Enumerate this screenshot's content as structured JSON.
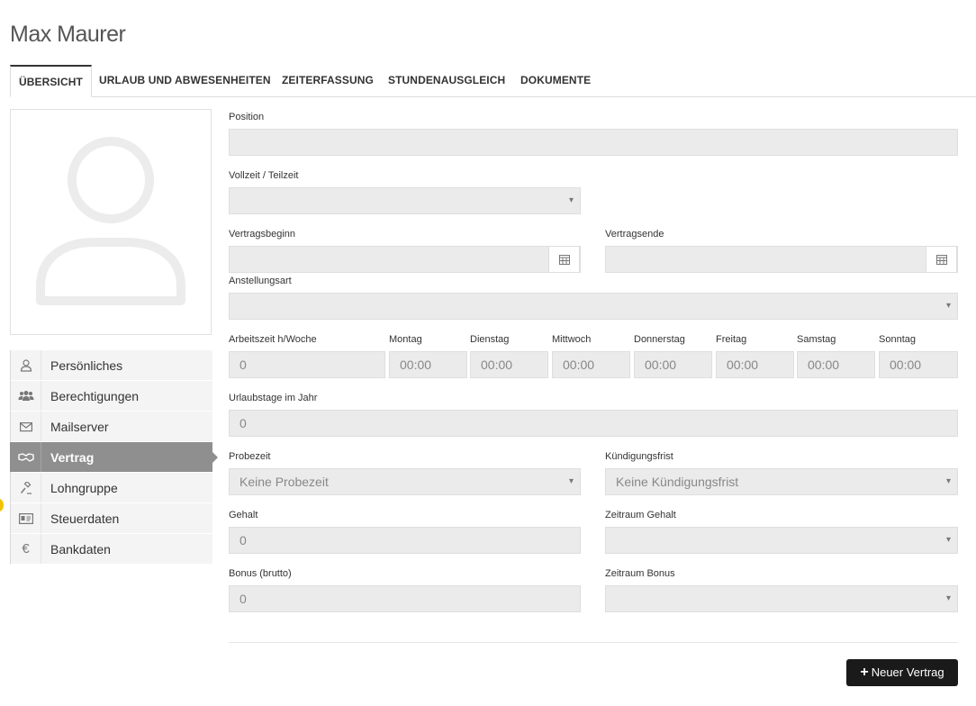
{
  "page_title": "Max Maurer",
  "tabs": [
    {
      "label": "ÜBERSICHT",
      "active": true
    },
    {
      "label": "URLAUB UND ABWESENHEITEN"
    },
    {
      "label": "ZEITERFASSUNG"
    },
    {
      "label": "STUNDENAUSGLEICH"
    },
    {
      "label": "DOKUMENTE"
    }
  ],
  "sidebar": {
    "items": [
      {
        "label": "Persönliches",
        "icon": "user-icon"
      },
      {
        "label": "Berechtigungen",
        "icon": "users-icon"
      },
      {
        "label": "Mailserver",
        "icon": "envelope-icon"
      },
      {
        "label": "Vertrag",
        "icon": "handshake-icon",
        "active": true
      },
      {
        "label": "Lohngruppe",
        "icon": "gavel-icon"
      },
      {
        "label": "Steuerdaten",
        "icon": "id-card-icon"
      },
      {
        "label": "Bankdaten",
        "icon": "euro-icon"
      }
    ]
  },
  "form": {
    "position": {
      "label": "Position",
      "value": ""
    },
    "vollzeit": {
      "label": "Vollzeit / Teilzeit",
      "value": ""
    },
    "vertragsbeginn": {
      "label": "Vertragsbeginn",
      "value": ""
    },
    "vertragsende": {
      "label": "Vertragsende",
      "value": ""
    },
    "anstellungsart": {
      "label": "Anstellungsart",
      "value": ""
    },
    "arbeitszeit": {
      "label": "Arbeitszeit h/Woche",
      "value": "0"
    },
    "days": [
      {
        "label": "Montag",
        "value": "00:00"
      },
      {
        "label": "Dienstag",
        "value": "00:00"
      },
      {
        "label": "Mittwoch",
        "value": "00:00"
      },
      {
        "label": "Donnerstag",
        "value": "00:00"
      },
      {
        "label": "Freitag",
        "value": "00:00"
      },
      {
        "label": "Samstag",
        "value": "00:00"
      },
      {
        "label": "Sonntag",
        "value": "00:00"
      }
    ],
    "urlaubstage": {
      "label": "Urlaubstage im Jahr",
      "value": "0"
    },
    "probezeit": {
      "label": "Probezeit",
      "value": "Keine Probezeit"
    },
    "kuendigungsfrist": {
      "label": "Kündigungsfrist",
      "value": "Keine Kündigungsfrist"
    },
    "gehalt": {
      "label": "Gehalt",
      "value": "0"
    },
    "zeitraum_gehalt": {
      "label": "Zeitraum Gehalt",
      "value": ""
    },
    "bonus": {
      "label": "Bonus (brutto)",
      "value": "0"
    },
    "zeitraum_bonus": {
      "label": "Zeitraum Bonus",
      "value": ""
    }
  },
  "new_contract_button": "Neuer Vertrag",
  "colors": {
    "accent": "#8f8f8f",
    "button": "#1a1a1a",
    "input_bg": "#ebebeb"
  }
}
